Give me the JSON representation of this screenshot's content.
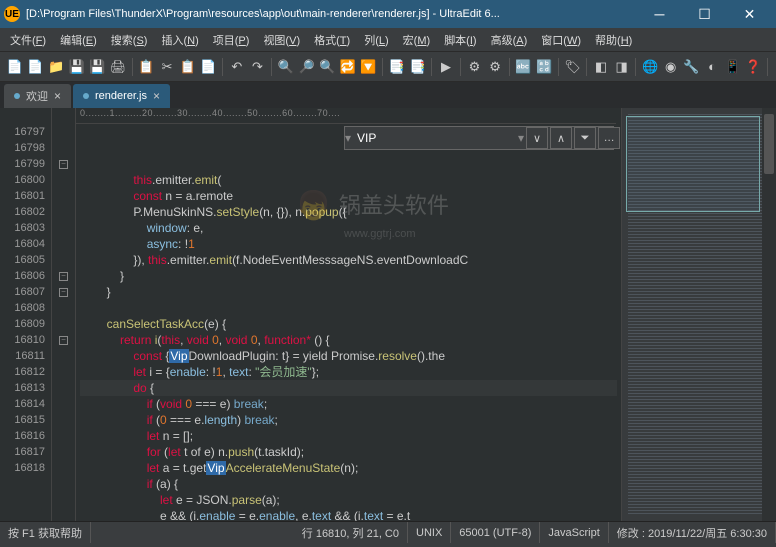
{
  "window": {
    "title": "[D:\\Program Files\\ThunderX\\Program\\resources\\app\\out\\main-renderer\\renderer.js] - UltraEdit 6...",
    "app_icon_label": "UE"
  },
  "menu": [
    {
      "label": "文件",
      "key": "F"
    },
    {
      "label": "编辑",
      "key": "E"
    },
    {
      "label": "搜索",
      "key": "S"
    },
    {
      "label": "插入",
      "key": "N"
    },
    {
      "label": "项目",
      "key": "P"
    },
    {
      "label": "视图",
      "key": "V"
    },
    {
      "label": "格式",
      "key": "T"
    },
    {
      "label": "列",
      "key": "L"
    },
    {
      "label": "宏",
      "key": "M"
    },
    {
      "label": "脚本",
      "key": "I"
    },
    {
      "label": "高级",
      "key": "A"
    },
    {
      "label": "窗口",
      "key": "W"
    },
    {
      "label": "帮助",
      "key": "H"
    }
  ],
  "toolbar_icons": [
    "📄",
    "📄",
    "📁",
    "💾",
    "💾",
    "🖨",
    "|",
    "📋",
    "✂",
    "📋",
    "📄",
    "|",
    "↶",
    "↷",
    "|",
    "🔍",
    "🔎",
    "🔍",
    "🔁",
    "🔽",
    "|",
    "📑",
    "📑",
    "|",
    "▶",
    "|",
    "⚙",
    "⚙",
    "|",
    "🔤",
    "🔡",
    "|",
    "🏷",
    "|",
    "◧",
    "◨",
    "|",
    "🌐",
    "◉",
    "🔧",
    "◐",
    "📱",
    "❓",
    "|"
  ],
  "tabs": [
    {
      "label": "欢迎",
      "active": false,
      "icon": "dot"
    },
    {
      "label": "renderer.js",
      "active": true,
      "icon": "dot"
    }
  ],
  "search": {
    "value": "VIP",
    "buttons": [
      "∨",
      "∧",
      "⏷",
      "…"
    ]
  },
  "ruler": "0........1.........20........30........40........50........60........70....",
  "gutter_start": 16797,
  "gutter_count": 22,
  "fold_marks": {
    "0": "",
    "1": "",
    "2": "-",
    "3": "",
    "4": "",
    "5": "",
    "6": "",
    "7": "",
    "8": "",
    "9": "-",
    "10": "-",
    "11": "",
    "12": "",
    "13": "-",
    "14": "",
    "15": "",
    "16": "",
    "17": "",
    "18": "",
    "19": "",
    "20": "",
    "21": ""
  },
  "code_lines": [
    {
      "indent": 16,
      "segs": [
        {
          "c": "kw-this",
          "t": "this"
        },
        {
          "t": ".emitter."
        },
        {
          "c": "fn",
          "t": "emit"
        },
        {
          "t": "("
        }
      ]
    },
    {
      "indent": 16,
      "segs": [
        {
          "c": "kw-const",
          "t": "const"
        },
        {
          "t": " n = a.remote"
        }
      ]
    },
    {
      "indent": 16,
      "segs": [
        {
          "t": "P.MenuSkinNS."
        },
        {
          "c": "fn",
          "t": "setStyle"
        },
        {
          "t": "(n, {}), n."
        },
        {
          "c": "fn",
          "t": "popup"
        },
        {
          "t": "({"
        }
      ]
    },
    {
      "indent": 20,
      "segs": [
        {
          "c": "prop",
          "t": "window"
        },
        {
          "t": ": e,"
        }
      ]
    },
    {
      "indent": 20,
      "segs": [
        {
          "c": "prop",
          "t": "async"
        },
        {
          "t": ": !"
        },
        {
          "c": "num",
          "t": "1"
        }
      ]
    },
    {
      "indent": 16,
      "segs": [
        {
          "t": "}), "
        },
        {
          "c": "kw-this",
          "t": "this"
        },
        {
          "t": ".emitter."
        },
        {
          "c": "fn",
          "t": "emit"
        },
        {
          "t": "(f.NodeEventMesssageNS.eventDownloadC"
        }
      ]
    },
    {
      "indent": 12,
      "segs": [
        {
          "t": "}"
        }
      ]
    },
    {
      "indent": 8,
      "segs": [
        {
          "t": "}"
        }
      ]
    },
    {
      "indent": 8,
      "segs": [
        {
          "t": ""
        }
      ]
    },
    {
      "indent": 8,
      "segs": [
        {
          "c": "fn",
          "t": "canSelectTaskAcc"
        },
        {
          "t": "(e) {"
        }
      ]
    },
    {
      "indent": 12,
      "segs": [
        {
          "c": "kw-return",
          "t": "return"
        },
        {
          "t": " "
        },
        {
          "c": "fn",
          "t": "i"
        },
        {
          "t": "("
        },
        {
          "c": "kw-this",
          "t": "this"
        },
        {
          "t": ", "
        },
        {
          "c": "kw-void",
          "t": "void"
        },
        {
          "t": " "
        },
        {
          "c": "num",
          "t": "0"
        },
        {
          "t": ", "
        },
        {
          "c": "kw-void",
          "t": "void"
        },
        {
          "t": " "
        },
        {
          "c": "num",
          "t": "0"
        },
        {
          "t": ", "
        },
        {
          "c": "kw-function",
          "t": "function*"
        },
        {
          "t": " () {"
        }
      ]
    },
    {
      "indent": 16,
      "segs": [
        {
          "c": "kw-const",
          "t": "const"
        },
        {
          "t": " {"
        },
        {
          "c": "hl",
          "t": "Vip"
        },
        {
          "t": "DownloadPlugin: t} = yield Promise."
        },
        {
          "c": "fn",
          "t": "resolve"
        },
        {
          "t": "().the"
        }
      ]
    },
    {
      "indent": 16,
      "segs": [
        {
          "c": "kw-let",
          "t": "let"
        },
        {
          "t": " i = {"
        },
        {
          "c": "prop",
          "t": "enable"
        },
        {
          "t": ": !"
        },
        {
          "c": "num",
          "t": "1"
        },
        {
          "t": ", "
        },
        {
          "c": "prop",
          "t": "text"
        },
        {
          "t": ": "
        },
        {
          "c": "str",
          "t": "\"会员加速\""
        },
        {
          "t": "};"
        }
      ]
    },
    {
      "indent": 16,
      "segs": [
        {
          "c": "kw-do",
          "t": "do"
        },
        {
          "t": " {"
        }
      ],
      "cur": true
    },
    {
      "indent": 20,
      "segs": [
        {
          "c": "kw-if",
          "t": "if"
        },
        {
          "t": " ("
        },
        {
          "c": "kw-void",
          "t": "void"
        },
        {
          "t": " "
        },
        {
          "c": "num",
          "t": "0"
        },
        {
          "t": " === e) "
        },
        {
          "c": "kw-break",
          "t": "break"
        },
        {
          "t": ";"
        }
      ]
    },
    {
      "indent": 20,
      "segs": [
        {
          "c": "kw-if",
          "t": "if"
        },
        {
          "t": " ("
        },
        {
          "c": "num",
          "t": "0"
        },
        {
          "t": " === e."
        },
        {
          "c": "prop",
          "t": "length"
        },
        {
          "t": ") "
        },
        {
          "c": "kw-break",
          "t": "break"
        },
        {
          "t": ";"
        }
      ]
    },
    {
      "indent": 20,
      "segs": [
        {
          "c": "kw-let",
          "t": "let"
        },
        {
          "t": " n = [];"
        }
      ]
    },
    {
      "indent": 20,
      "segs": [
        {
          "c": "kw-for",
          "t": "for"
        },
        {
          "t": " ("
        },
        {
          "c": "kw-let",
          "t": "let"
        },
        {
          "t": " t of e) n."
        },
        {
          "c": "fn",
          "t": "push"
        },
        {
          "t": "(t.taskId);"
        }
      ]
    },
    {
      "indent": 20,
      "segs": [
        {
          "c": "kw-let",
          "t": "let"
        },
        {
          "t": " a = t.get"
        },
        {
          "c": "hl",
          "t": "Vip"
        },
        {
          "c": "fn",
          "t": "AccelerateMenuState"
        },
        {
          "t": "(n);"
        }
      ]
    },
    {
      "indent": 20,
      "segs": [
        {
          "c": "kw-if",
          "t": "if"
        },
        {
          "t": " (a) {"
        }
      ]
    },
    {
      "indent": 24,
      "segs": [
        {
          "c": "kw-let",
          "t": "let"
        },
        {
          "t": " e = JSON."
        },
        {
          "c": "fn",
          "t": "parse"
        },
        {
          "t": "(a);"
        }
      ]
    },
    {
      "indent": 24,
      "segs": [
        {
          "t": "e && (i."
        },
        {
          "c": "prop",
          "t": "enable"
        },
        {
          "t": " = e."
        },
        {
          "c": "prop",
          "t": "enable"
        },
        {
          "t": ", e."
        },
        {
          "c": "prop",
          "t": "text"
        },
        {
          "t": " && (i."
        },
        {
          "c": "prop",
          "t": "text"
        },
        {
          "t": " = e.t"
        }
      ]
    }
  ],
  "watermark": {
    "text": "锅盖头软件",
    "sub": "www.ggtrj.com"
  },
  "status": {
    "help": "按 F1 获取帮助",
    "pos": "行 16810, 列 21, C0",
    "eol": "UNIX",
    "enc": "65001 (UTF-8)",
    "lang": "JavaScript",
    "mod": "修改 :  2019/11/22/周五 6:30:30"
  }
}
